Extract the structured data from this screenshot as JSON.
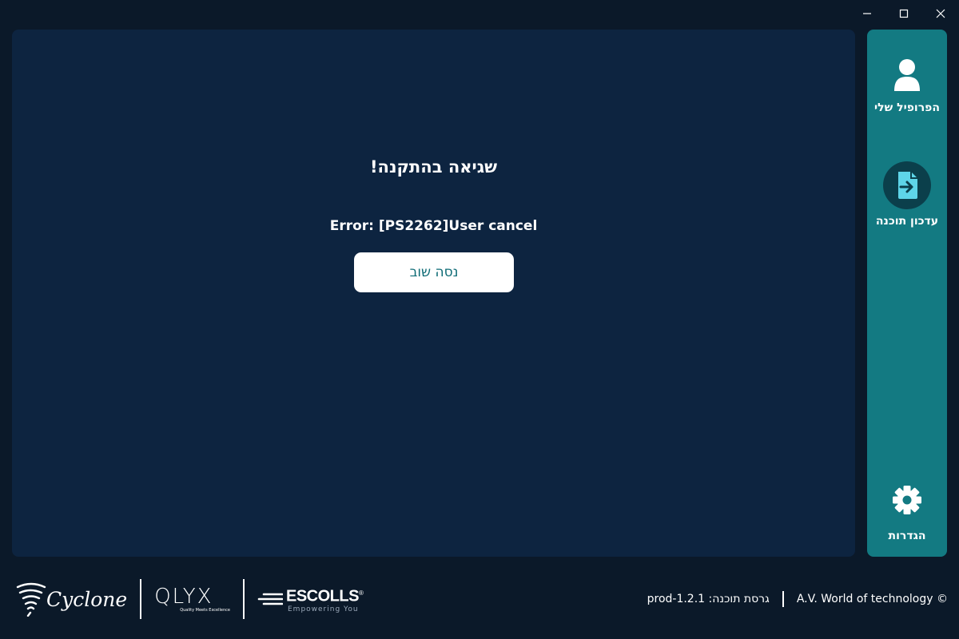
{
  "colors": {
    "background": "#0b1929",
    "main_panel": "#0d2440",
    "sidebar": "#137a82",
    "accent_icon": "#5ed5e8",
    "retry_text": "#0d6b75"
  },
  "window_controls": [
    {
      "name": "minimize",
      "icon": "minimize-icon"
    },
    {
      "name": "maximize",
      "icon": "maximize-icon"
    },
    {
      "name": "close",
      "icon": "close-icon"
    }
  ],
  "main": {
    "error_title": "שגיאה בהתקנה!",
    "error_message": "Error: [PS2262]User cancel",
    "retry_label": "נסה שוב"
  },
  "sidebar": {
    "items": [
      {
        "label": "הפרופיל שלי",
        "icon": "user-icon",
        "active": false
      },
      {
        "label": "עדכון תוכנה",
        "icon": "file-update-icon",
        "active": true
      },
      {
        "label": "הגדרות",
        "icon": "gear-icon",
        "active": false
      }
    ]
  },
  "footer": {
    "logos": {
      "cyclone": "Cyclone",
      "qlyx": "QLYX",
      "qlyx_tagline": "Quality Meets Excellence",
      "escolls": "ESCOLLS",
      "escolls_mark": "®",
      "escolls_tagline": "Empowering You"
    },
    "version": "גרסת תוכנה: prod-1.2.1",
    "copyright": "A.V. World of technology ©"
  }
}
